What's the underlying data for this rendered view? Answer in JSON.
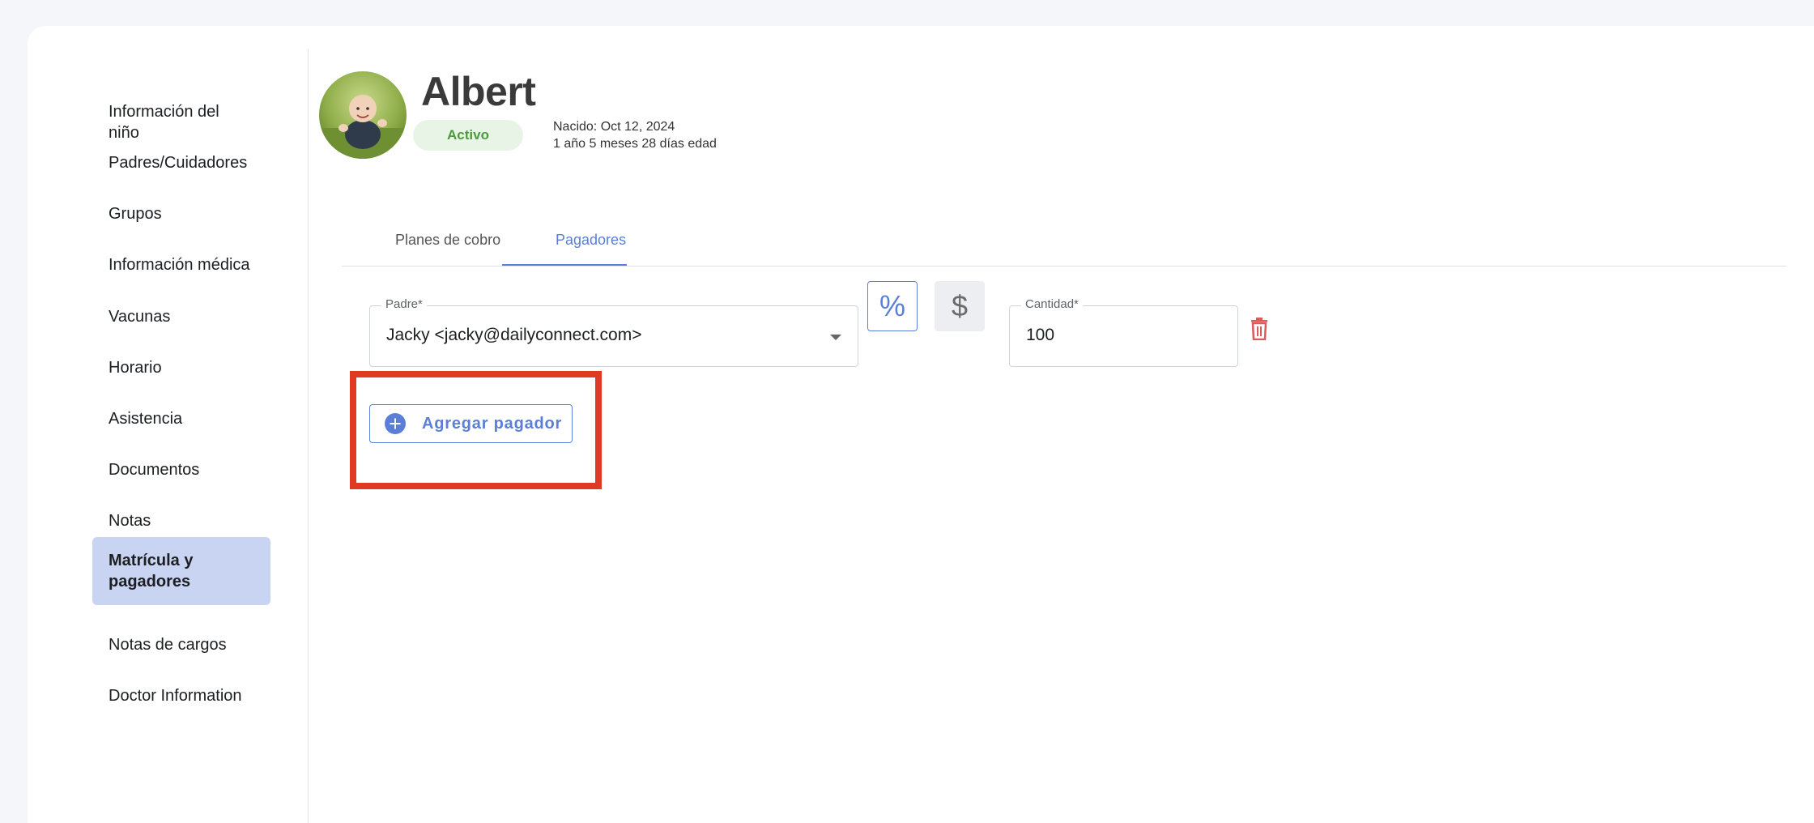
{
  "sidebar": {
    "items": [
      {
        "label": "Información del niño"
      },
      {
        "label": "Padres/Cuidadores"
      },
      {
        "label": "Grupos"
      },
      {
        "label": "Información médica"
      },
      {
        "label": "Vacunas"
      },
      {
        "label": "Horario"
      },
      {
        "label": "Asistencia"
      },
      {
        "label": "Documentos"
      },
      {
        "label": "Notas"
      },
      {
        "label": "Matrícula y pagadores",
        "active": true
      },
      {
        "label": "Notas de cargos"
      },
      {
        "label": "Doctor Information"
      }
    ]
  },
  "child": {
    "name": "Albert",
    "status": "Activo",
    "born": "Nacido: Oct 12, 2024",
    "age": "1 año 5 meses 28 días edad"
  },
  "tabs": [
    {
      "label": "Planes de cobro",
      "active": false
    },
    {
      "label": "Pagadores",
      "active": true
    }
  ],
  "payer": {
    "parent_label": "Padre*",
    "parent_value": "Jacky <jacky@dailyconnect.com>",
    "percent_symbol": "%",
    "dollar_symbol": "$",
    "amount_label": "Cantidad*",
    "amount_value": "100"
  },
  "add_payer_label": "Agregar pagador",
  "colors": {
    "accent": "#5b7fd8",
    "active_nav": "#c9d3f2",
    "status_green": "#4c9a3e",
    "highlight": "#e03a22",
    "delete": "#e05a5a"
  }
}
